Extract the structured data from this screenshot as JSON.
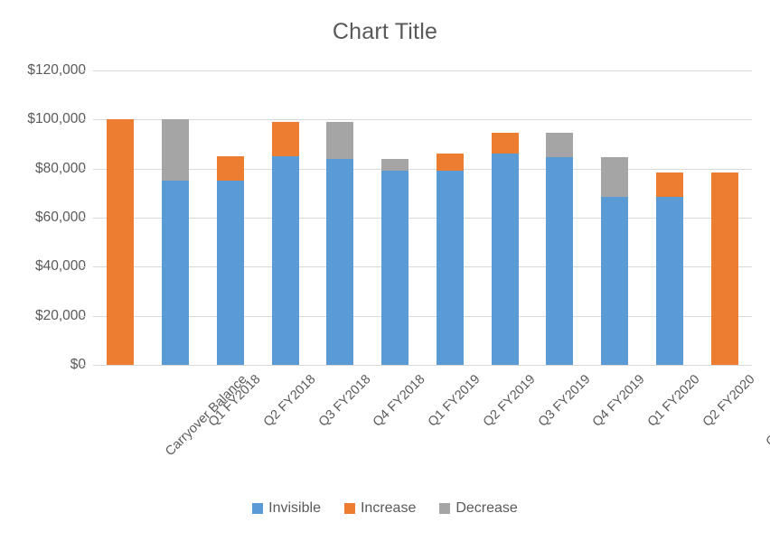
{
  "chart_data": {
    "type": "bar",
    "subtype": "stacked-waterfall",
    "title": "Chart Title",
    "subtitle": "",
    "xlabel": "",
    "ylabel": "",
    "ylim": [
      0,
      120000
    ],
    "ytick_labels": [
      "$120,000",
      "$100,000",
      "$80,000",
      "$60,000",
      "$40,000",
      "$20,000",
      "$0"
    ],
    "ytick_values": [
      120000,
      100000,
      80000,
      60000,
      40000,
      20000,
      0
    ],
    "grid": true,
    "legend_position": "bottom",
    "categories": [
      "Carryover Balance",
      "Q1 FY2018",
      "Q2 FY2018",
      "Q3 FY2018",
      "Q4 FY2018",
      "Q1 FY2019",
      "Q2 FY2019",
      "Q3 FY2019",
      "Q4 FY2019",
      "Q1 FY2020",
      "Q2 FY2020",
      "Current Balance"
    ],
    "series": [
      {
        "name": "Invisible",
        "color": "#5B9BD5",
        "values": [
          0,
          75000,
          75000,
          85000,
          84000,
          79000,
          79000,
          86000,
          84500,
          68500,
          68500,
          0
        ]
      },
      {
        "name": "Increase",
        "color": "#ED7D31",
        "values": [
          100000,
          0,
          10000,
          14000,
          0,
          0,
          7000,
          8500,
          0,
          0,
          10000,
          78500
        ]
      },
      {
        "name": "Decrease",
        "color": "#A5A5A5",
        "values": [
          0,
          25000,
          0,
          0,
          15000,
          5000,
          0,
          0,
          10000,
          16000,
          0,
          0
        ]
      }
    ],
    "bar_tops": [
      100000,
      100000,
      85000,
      99000,
      99000,
      84000,
      86000,
      94500,
      94500,
      84500,
      78500,
      78500
    ],
    "legend": [
      {
        "label": "Invisible",
        "color": "#5B9BD5"
      },
      {
        "label": "Increase",
        "color": "#ED7D31"
      },
      {
        "label": "Decrease",
        "color": "#A5A5A5"
      }
    ]
  },
  "colors": {
    "invisible": "#5B9BD5",
    "increase": "#ED7D31",
    "decrease": "#A5A5A5",
    "gridline": "#D9D9D9",
    "text": "#595959",
    "background": "#FFFFFF"
  }
}
